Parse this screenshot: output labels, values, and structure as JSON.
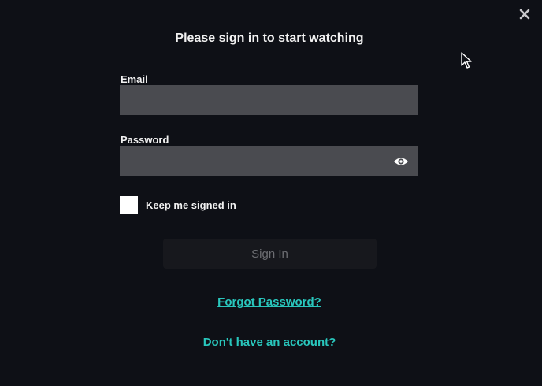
{
  "modal": {
    "title": "Please sign in to start watching",
    "close_icon": "close-icon"
  },
  "email": {
    "label": "Email",
    "value": "",
    "placeholder": ""
  },
  "password": {
    "label": "Password",
    "value": "",
    "placeholder": "",
    "toggle_icon": "eye-icon"
  },
  "remember": {
    "label": "Keep me signed in",
    "checked": false
  },
  "signin": {
    "label": "Sign In"
  },
  "links": {
    "forgot": "Forgot Password?",
    "signup": "Don't have an account?"
  },
  "colors": {
    "background": "#0e1016",
    "input_bg": "#4a4b50",
    "accent_link": "#29c7bd",
    "button_bg": "#17181d",
    "button_text": "#6d6e73"
  }
}
